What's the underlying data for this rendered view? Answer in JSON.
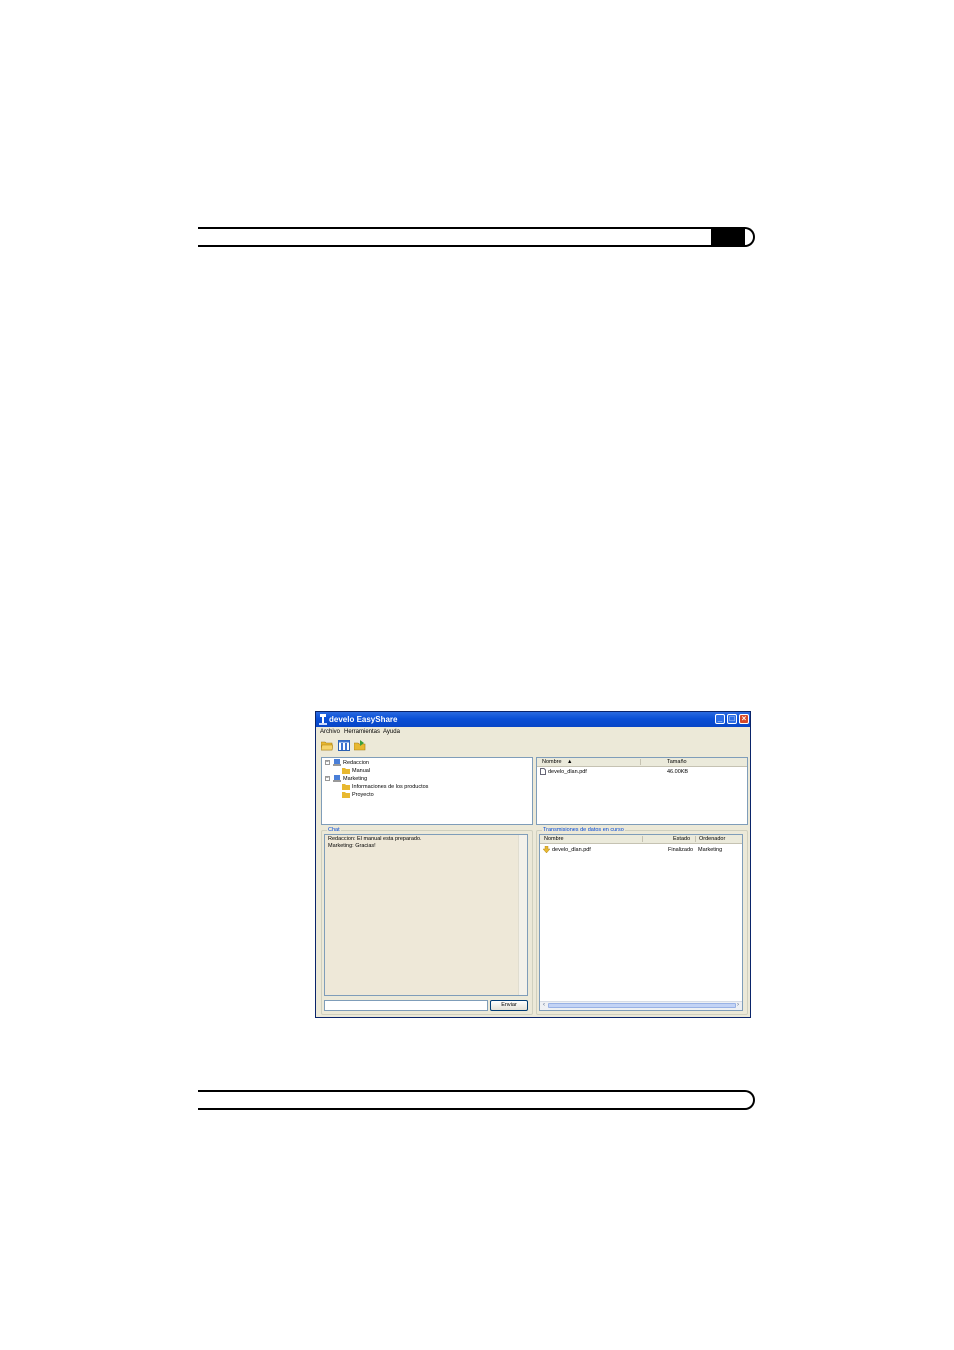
{
  "window": {
    "title": "develo EasyShare",
    "controls": {
      "minimize": "_",
      "maximize": "□",
      "close": "×"
    }
  },
  "menu": [
    "Archivo",
    "Herramientas",
    "Ayuda"
  ],
  "toolbar": [
    {
      "icon": "open-folder-icon"
    },
    {
      "icon": "columns-icon"
    },
    {
      "icon": "folder-share-icon"
    }
  ],
  "tree": {
    "groups": [
      {
        "label": "Redaccion",
        "expander": "−",
        "children": [
          "Manual"
        ]
      },
      {
        "label": "Marketing",
        "expander": "−",
        "children": [
          "Informaciones de los productos",
          "Proyecto"
        ]
      }
    ]
  },
  "files": {
    "columns": {
      "name": "Nombre",
      "sort": "▲",
      "size": "Tamaño"
    },
    "rows": [
      {
        "name": "develo_dlan.pdf",
        "size": "46.00KB"
      }
    ]
  },
  "chat": {
    "label": "Chat",
    "messages": [
      "Redaccion: El manual esta preparado.",
      "Marketing: Gracias!"
    ],
    "input_value": "",
    "send_label": "Enviar"
  },
  "transfers": {
    "label": "Transmisiones de datos en curso",
    "columns": {
      "name": "Nombre",
      "status": "Estado",
      "computer": "Ordenador"
    },
    "rows": [
      {
        "name": "develo_dlan.pdf",
        "status": "Finalizado",
        "computer": "Marketing"
      }
    ]
  },
  "colors": {
    "titlebar": "#0a4fd6",
    "window_bg": "#ece9d8",
    "group_label": "#0046d5"
  }
}
